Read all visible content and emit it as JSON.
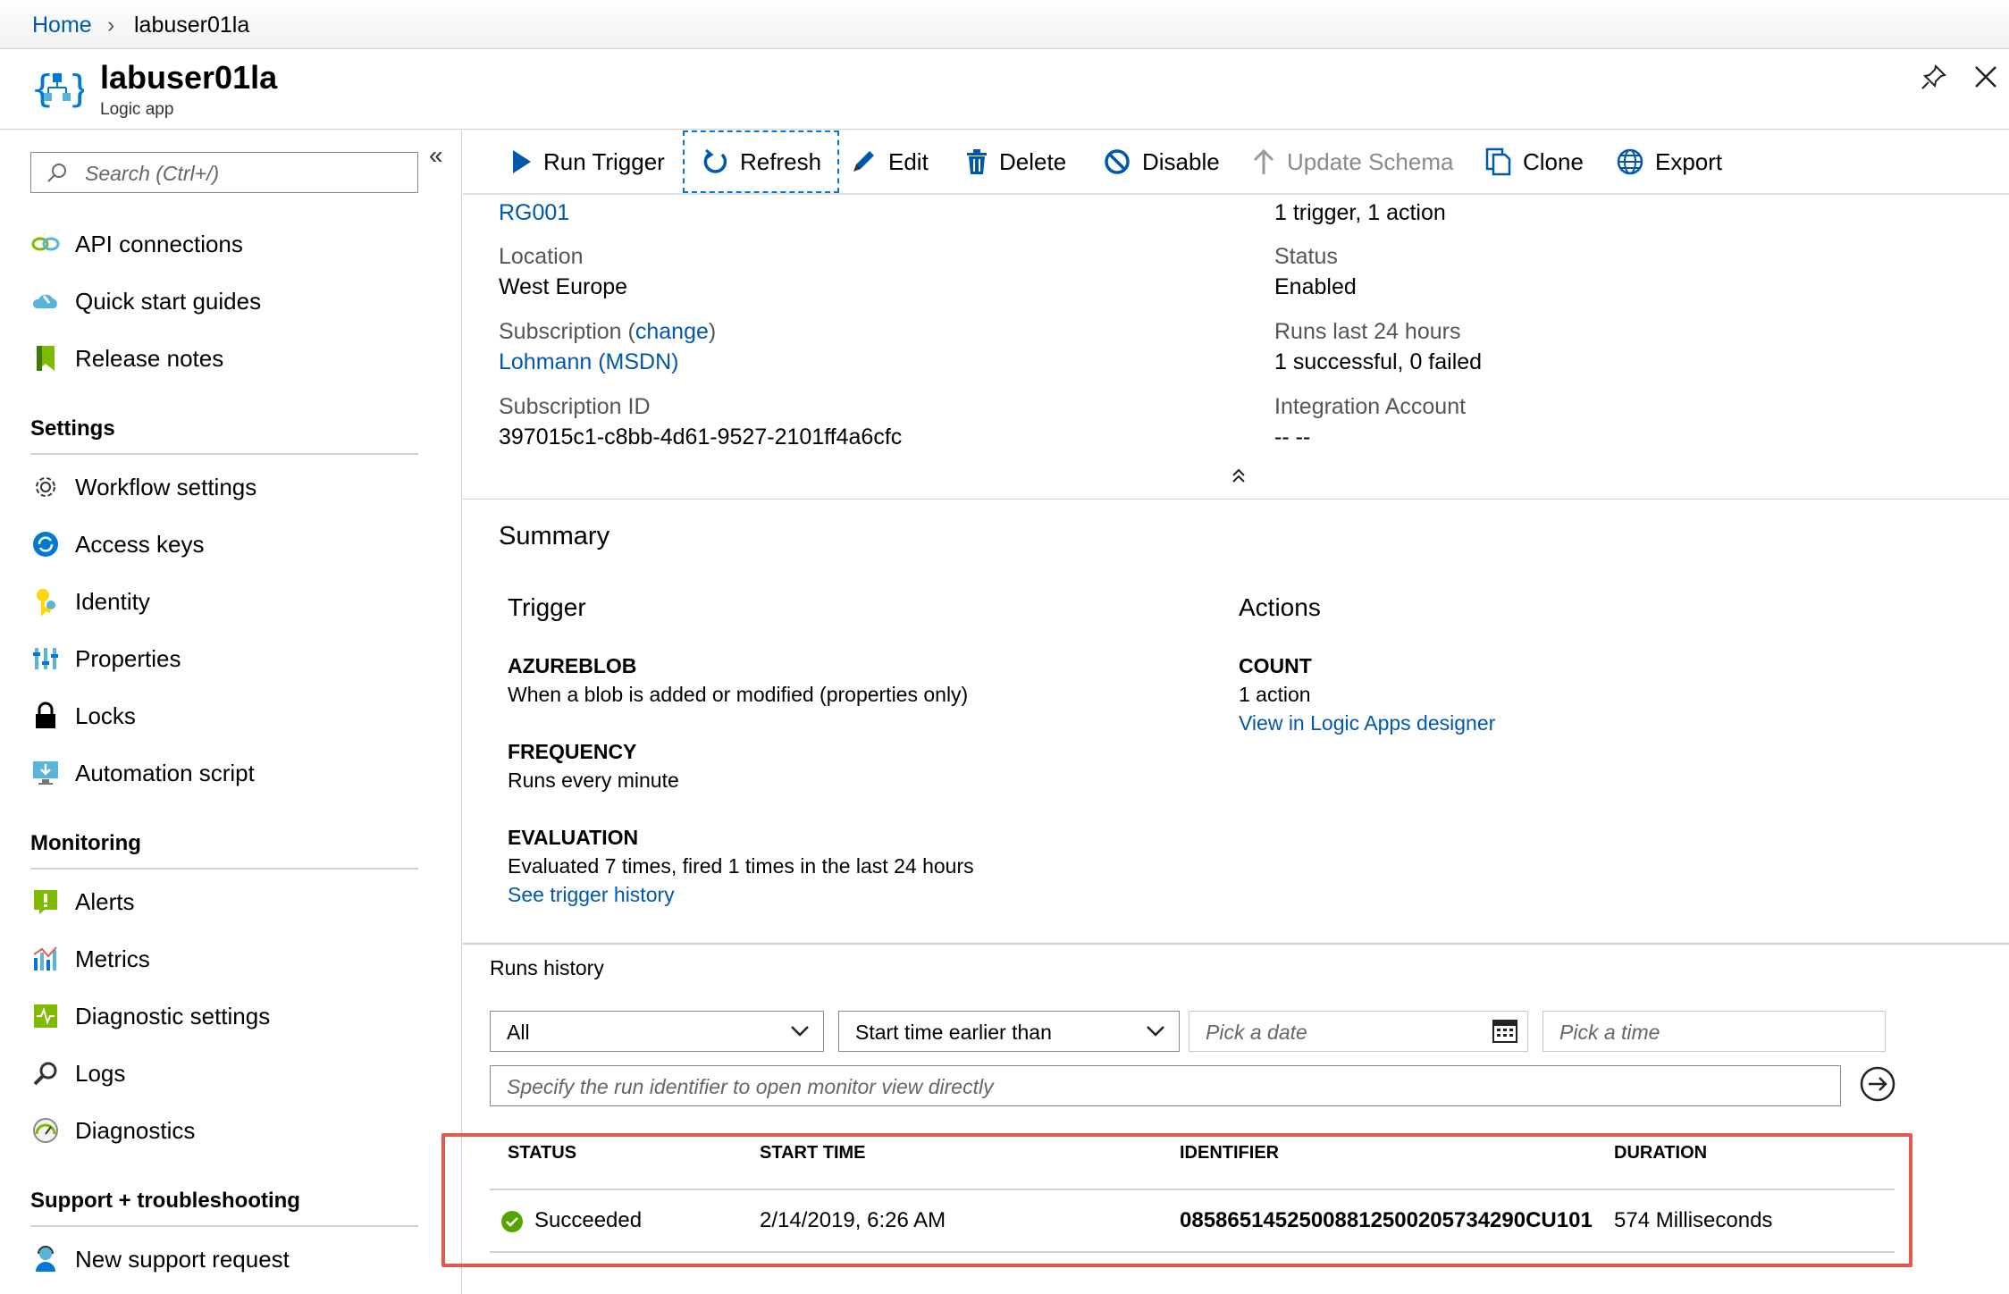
{
  "breadcrumb": {
    "home": "Home",
    "current": "labuser01la"
  },
  "header": {
    "title": "labuser01la",
    "subtitle": "Logic app"
  },
  "search": {
    "placeholder": "Search (Ctrl+/)"
  },
  "sidebar": {
    "items_top": [
      {
        "label": "API connections",
        "icon": "link-icon"
      },
      {
        "label": "Quick start guides",
        "icon": "cloud-icon"
      },
      {
        "label": "Release notes",
        "icon": "bookmark-icon"
      }
    ],
    "settings_heading": "Settings",
    "settings": [
      {
        "label": "Workflow settings",
        "icon": "gear-icon"
      },
      {
        "label": "Access keys",
        "icon": "key-refresh-icon"
      },
      {
        "label": "Identity",
        "icon": "identity-icon"
      },
      {
        "label": "Properties",
        "icon": "properties-icon"
      },
      {
        "label": "Locks",
        "icon": "lock-icon"
      },
      {
        "label": "Automation script",
        "icon": "monitor-download-icon"
      }
    ],
    "monitoring_heading": "Monitoring",
    "monitoring": [
      {
        "label": "Alerts",
        "icon": "alert-icon"
      },
      {
        "label": "Metrics",
        "icon": "metrics-icon"
      },
      {
        "label": "Diagnostic settings",
        "icon": "diagnostic-settings-icon"
      },
      {
        "label": "Logs",
        "icon": "search-logs-icon"
      },
      {
        "label": "Diagnostics",
        "icon": "gauge-icon"
      }
    ],
    "support_heading": "Support + troubleshooting",
    "support": [
      {
        "label": "New support request",
        "icon": "support-person-icon"
      }
    ]
  },
  "toolbar": {
    "run_trigger": "Run Trigger",
    "refresh": "Refresh",
    "edit": "Edit",
    "delete": "Delete",
    "disable": "Disable",
    "update_schema": "Update Schema",
    "clone": "Clone",
    "export": "Export"
  },
  "essentials": {
    "resource_group_value": "RG001",
    "location_label": "Location",
    "location_value": "West Europe",
    "subscription_label": "Subscription",
    "subscription_change": "change",
    "subscription_value": "Lohmann (MSDN)",
    "subscription_id_label": "Subscription ID",
    "subscription_id_value": "397015c1-c8bb-4d61-9527-2101ff4a6cfc",
    "definition_value": "1 trigger, 1 action",
    "status_label": "Status",
    "status_value": "Enabled",
    "runs_label": "Runs last 24 hours",
    "runs_value": "1 successful, 0 failed",
    "integration_label": "Integration Account",
    "integration_value": "-- --"
  },
  "summary": {
    "heading": "Summary",
    "trigger_heading": "Trigger",
    "azureblob_label": "AZUREBLOB",
    "azureblob_value": "When a blob is added or modified (properties only)",
    "frequency_label": "FREQUENCY",
    "frequency_value": "Runs every minute",
    "evaluation_label": "EVALUATION",
    "evaluation_value": "Evaluated 7 times, fired 1 times in the last 24 hours",
    "trigger_history_link": "See trigger history",
    "actions_heading": "Actions",
    "count_label": "COUNT",
    "count_value": "1 action",
    "designer_link": "View in Logic Apps designer"
  },
  "runs": {
    "heading": "Runs history",
    "status_filter": "All",
    "time_filter": "Start time earlier than",
    "date_placeholder": "Pick a date",
    "time_placeholder": "Pick a time",
    "identifier_placeholder": "Specify the run identifier to open monitor view directly",
    "columns": [
      "STATUS",
      "START TIME",
      "IDENTIFIER",
      "DURATION"
    ],
    "rows": [
      {
        "status": "Succeeded",
        "start_time": "2/14/2019, 6:26 AM",
        "identifier": "08586514525008812500205734290CU101",
        "duration": "574 Milliseconds"
      }
    ]
  },
  "colors": {
    "accent": "#0058ad",
    "highlight": "#e05a4f",
    "success": "#57a300"
  }
}
